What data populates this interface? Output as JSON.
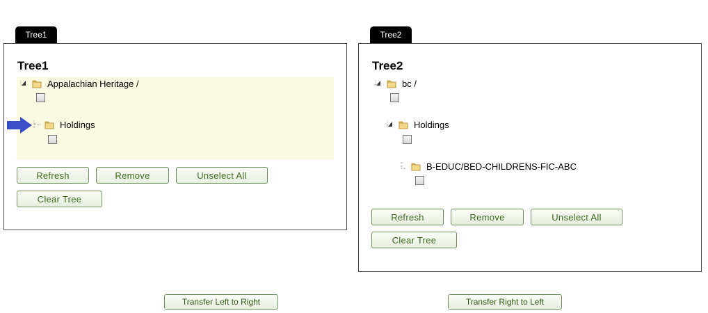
{
  "tree1": {
    "tab_label": "Tree1",
    "title": "Tree1",
    "nodes": [
      {
        "label": "Appalachian Heritage /",
        "icon": "folder-icon"
      },
      {
        "label": "Holdings",
        "icon": "folder-icon"
      }
    ],
    "buttons": {
      "refresh": "Refresh",
      "remove": "Remove",
      "unselect_all": "Unselect All",
      "clear_tree": "Clear Tree"
    }
  },
  "tree2": {
    "tab_label": "Tree2",
    "title": "Tree2",
    "nodes": [
      {
        "label": "bc /",
        "icon": "folder-icon"
      },
      {
        "label": "Holdings",
        "icon": "folder-icon"
      },
      {
        "label": "B-EDUC/BED-CHILDRENS-FIC-ABC",
        "icon": "folder-icon"
      }
    ],
    "buttons": {
      "refresh": "Refresh",
      "remove": "Remove",
      "unselect_all": "Unselect All",
      "clear_tree": "Clear Tree"
    }
  },
  "transfer": {
    "left_to_right": "Transfer Left to Right",
    "right_to_left": "Transfer Right to Left"
  },
  "colors": {
    "tab_bg": "#000000",
    "highlight_bg": "#fbfbe4",
    "button_text": "#3b6a1c",
    "button_border": "#6f8f5a",
    "pointer_arrow": "#3a4ec8"
  }
}
